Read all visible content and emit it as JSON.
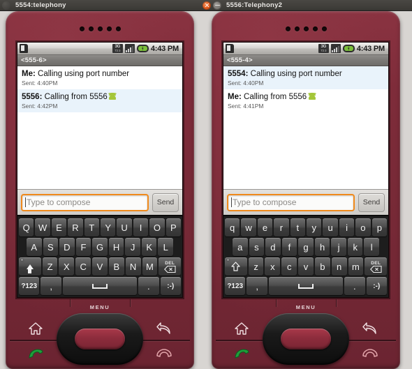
{
  "windows": [
    {
      "title": "5554:telephony",
      "buttons": {
        "close": "close-button",
        "minimize": "minimize-button"
      },
      "active": false
    },
    {
      "title": "5556:Telephony2",
      "buttons": {
        "close": "close-button",
        "minimize": "minimize-button"
      },
      "active": true
    }
  ],
  "phones": [
    {
      "id": "emulator-5554",
      "statusbar": {
        "sim_icon": "sim-card-alert-icon",
        "network": {
          "label": "3G",
          "sub": "T2 3"
        },
        "signal_icon": "signal-bars-icon",
        "battery_icon": "battery-charging-icon",
        "time": "4:43 PM"
      },
      "recipient": "<555-6>",
      "messages": [
        {
          "sender": "Me",
          "text": "Calling using port number",
          "sent": "Sent: 4:40PM",
          "highlight": false,
          "emoji": false
        },
        {
          "sender": "5556",
          "text": "Calling from 5556",
          "sent": "Sent: 4:42PM",
          "highlight": true,
          "emoji": true
        }
      ],
      "compose": {
        "placeholder": "Type to compose",
        "value": "",
        "send_label": "Send"
      },
      "keyboard": {
        "shift_active": true,
        "row1": [
          "Q",
          "W",
          "E",
          "R",
          "T",
          "Y",
          "U",
          "I",
          "O",
          "P"
        ],
        "row2": [
          "A",
          "S",
          "D",
          "F",
          "G",
          "H",
          "J",
          "K",
          "L"
        ],
        "row3": [
          "Z",
          "X",
          "C",
          "V",
          "B",
          "N",
          "M"
        ],
        "shift_label": "shift-key",
        "del_label": "DEL",
        "row4": {
          "sym": "?123",
          "comma": ",",
          "space": "space-bar",
          "period": ".",
          "emoji": ":-)"
        }
      },
      "hardware": {
        "menu_label": "MENU",
        "home": "home-icon",
        "back": "back-icon",
        "call": "call-icon",
        "end": "end-call-icon",
        "dpad": "dpad-control"
      }
    },
    {
      "id": "emulator-5556",
      "statusbar": {
        "sim_icon": "sim-card-alert-icon",
        "network": {
          "label": "3G",
          "sub": "T2 3"
        },
        "signal_icon": "signal-bars-icon",
        "battery_icon": "battery-charging-icon",
        "time": "4:43 PM"
      },
      "recipient": "<555-4>",
      "messages": [
        {
          "sender": "5554",
          "text": "Calling using port number",
          "sent": "Sent: 4:40PM",
          "highlight": true,
          "emoji": false
        },
        {
          "sender": "Me",
          "text": "Calling from 5556",
          "sent": "Sent: 4:41PM",
          "highlight": false,
          "emoji": true
        }
      ],
      "compose": {
        "placeholder": "Type to compose",
        "value": "",
        "send_label": "Send"
      },
      "keyboard": {
        "shift_active": false,
        "row1": [
          "q",
          "w",
          "e",
          "r",
          "t",
          "y",
          "u",
          "i",
          "o",
          "p"
        ],
        "row2": [
          "a",
          "s",
          "d",
          "f",
          "g",
          "h",
          "j",
          "k",
          "l"
        ],
        "row3": [
          "z",
          "x",
          "c",
          "v",
          "b",
          "n",
          "m"
        ],
        "shift_label": "shift-key",
        "del_label": "DEL",
        "row4": {
          "sym": "?123",
          "comma": ",",
          "space": "space-bar",
          "period": ".",
          "emoji": ":-)"
        }
      },
      "hardware": {
        "menu_label": "MENU",
        "home": "home-icon",
        "back": "back-icon",
        "call": "call-icon",
        "end": "end-call-icon",
        "dpad": "dpad-control"
      }
    }
  ],
  "colors": {
    "phone_body": "#7e2c3a",
    "desktop_bg": "#d8d5d2",
    "titlebar_bg": "#3c3b37",
    "focus_orange": "#f08a1c",
    "highlight_blue": "#e9f3fb",
    "battery_green": "#7bbf3a",
    "android_green": "#a4c639",
    "close_orange": "#df5a1e"
  }
}
